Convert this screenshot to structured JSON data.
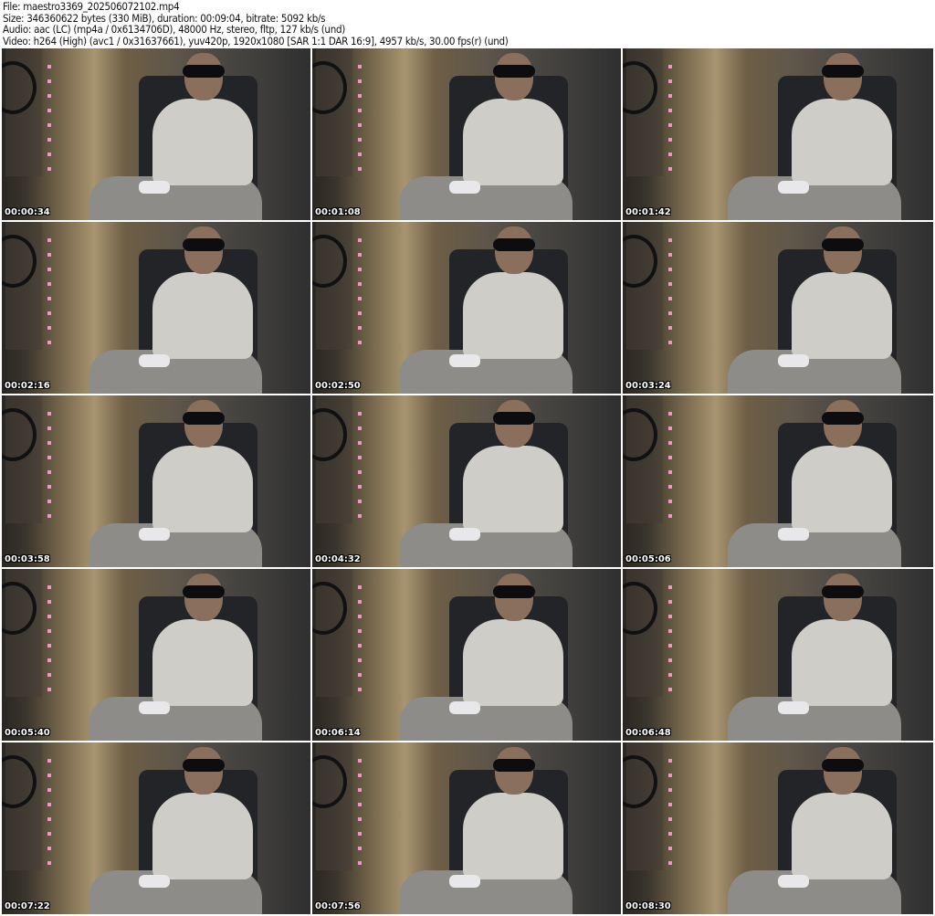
{
  "header": {
    "file": "File: maestro3369_202506072102.mp4",
    "size": "Size: 346360622 bytes (330 MiB), duration: 00:09:04, bitrate: 5092 kb/s",
    "audio": "Audio: aac (LC) (mp4a / 0x6134706D), 48000 Hz, stereo, fltp, 127 kb/s (und)",
    "video": "Video: h264 (High) (avc1 / 0x31637661), yuv420p, 1920x1080 [SAR 1:1 DAR 16:9], 4957 kb/s, 30.00 fps(r) (und)"
  },
  "thumbnails": [
    {
      "timestamp": "00:00:34"
    },
    {
      "timestamp": "00:01:08"
    },
    {
      "timestamp": "00:01:42"
    },
    {
      "timestamp": "00:02:16"
    },
    {
      "timestamp": "00:02:50"
    },
    {
      "timestamp": "00:03:24"
    },
    {
      "timestamp": "00:03:58"
    },
    {
      "timestamp": "00:04:32"
    },
    {
      "timestamp": "00:05:06"
    },
    {
      "timestamp": "00:05:40"
    },
    {
      "timestamp": "00:06:14"
    },
    {
      "timestamp": "00:06:48"
    },
    {
      "timestamp": "00:07:22"
    },
    {
      "timestamp": "00:07:56"
    },
    {
      "timestamp": "00:08:30"
    }
  ]
}
